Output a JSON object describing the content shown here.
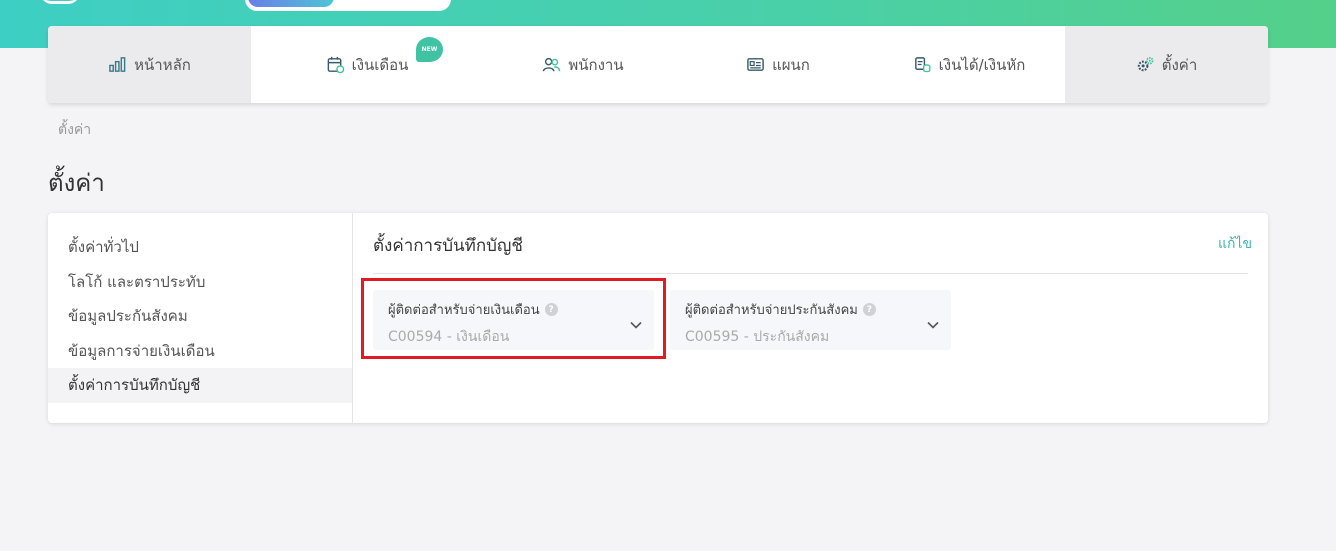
{
  "nav": {
    "items": [
      {
        "label": "หน้าหลัก",
        "icon": "bar-chart-icon"
      },
      {
        "label": "เงินเดือน",
        "icon": "calendar-icon",
        "badge": "NEW"
      },
      {
        "label": "พนักงาน",
        "icon": "users-icon"
      },
      {
        "label": "แผนก",
        "icon": "id-card-icon"
      },
      {
        "label": "เงินได้/เงินหัก",
        "icon": "coins-icon"
      },
      {
        "label": "ตั้งค่า",
        "icon": "gear-icon"
      }
    ]
  },
  "breadcrumb": "ตั้งค่า",
  "page_title": "ตั้งค่า",
  "side_menu": {
    "items": [
      {
        "label": "ตั้งค่าทั่วไป"
      },
      {
        "label": "โลโก้ และตราประทับ"
      },
      {
        "label": "ข้อมูลประกันสังคม"
      },
      {
        "label": "ข้อมูลการจ่ายเงินเดือน"
      },
      {
        "label": "ตั้งค่าการบันทึกบัญชี"
      }
    ],
    "active_index": 4
  },
  "content": {
    "title": "ตั้งค่าการบันทึกบัญชี",
    "edit_label": "แก้ไข",
    "fields": [
      {
        "label": "ผู้ติดต่อสำหรับจ่ายเงินเดือน",
        "value": "C00594 - เงินเดือน"
      },
      {
        "label": "ผู้ติดต่อสำหรับจ่ายประกันสังคม",
        "value": "C00595 - ประกันสังคม"
      }
    ]
  },
  "colors": {
    "accent": "#3db6b0",
    "highlight": "#e01b24",
    "header_gradient_start": "#3ecfc4",
    "header_gradient_end": "#55d08a"
  }
}
